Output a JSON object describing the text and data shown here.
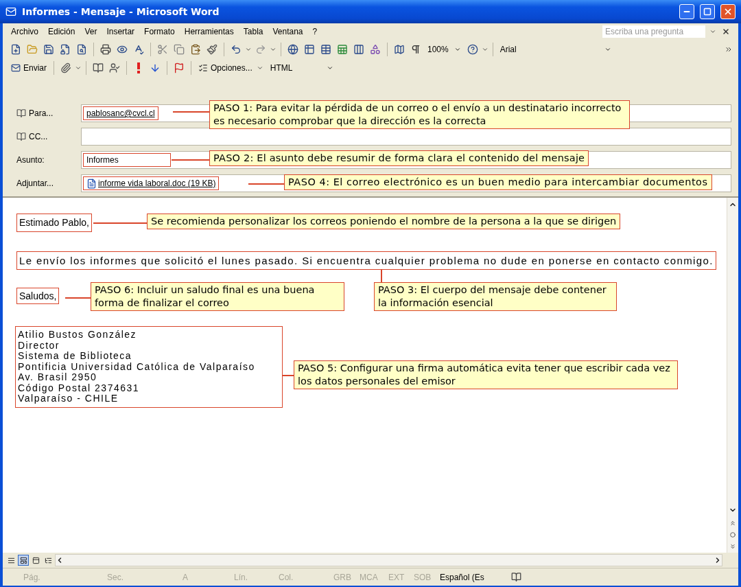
{
  "window": {
    "title": "Informes - Mensaje - Microsoft Word"
  },
  "menu": [
    {
      "label": "Archivo"
    },
    {
      "label": "Edición"
    },
    {
      "label": "Ver"
    },
    {
      "label": "Insertar"
    },
    {
      "label": "Formato"
    },
    {
      "label": "Herramientas"
    },
    {
      "label": "Tabla"
    },
    {
      "label": "Ventana"
    },
    {
      "label": "?"
    }
  ],
  "help_search": {
    "placeholder": "Escriba una pregunta"
  },
  "toolbar": {
    "zoom": "100%",
    "font": "Arial"
  },
  "mail_toolbar": {
    "send": "Enviar",
    "options": "Opciones...",
    "format": "HTML"
  },
  "header_fields": [
    {
      "kind": "address",
      "label": "Para...",
      "value": "pablosanc@cvcl.cl",
      "note": "PASO 1: Para evitar la pérdida de un correo o el envío a un destinatario incorrecto es necesario comprobar que la dirección es la correcta"
    },
    {
      "kind": "address",
      "label": "CC..."
    },
    {
      "kind": "text",
      "label": "Asunto:",
      "value": "Informes",
      "note": "PASO 2: El asunto debe resumir de forma clara el contenido del mensaje"
    },
    {
      "kind": "attachment",
      "label": "Adjuntar...",
      "value": "informe vida laboral.doc (19 KB)",
      "note": "PASO 4: El correo electrónico es un buen medio para intercambiar documentos"
    }
  ],
  "message": {
    "greeting": {
      "text": "Estimado Pablo,",
      "note": "Se recomienda personalizar los correos poniendo el nombre de la persona a la que se dirigen"
    },
    "body": {
      "text": "Le envío los informes que solicitó el lunes pasado. Si encuentra cualquier problema no dude en ponerse en contacto conmigo.",
      "note": "PASO 3: El cuerpo del mensaje debe contener la información esencial"
    },
    "closing": {
      "text": "Saludos,",
      "note": "PASO 6: Incluir un saludo final es una buena forma de finalizar el correo"
    },
    "signature": {
      "lines": [
        "Atilio Bustos González",
        "Director",
        "Sistema de Biblioteca",
        "Pontificia Universidad Católica de Valparaíso",
        "Av. Brasil 2950",
        "Código Postal 2374631",
        "Valparaíso - CHILE"
      ],
      "note": "PASO 5: Configurar una firma automática evita tener que escribir cada vez los datos personales del emisor"
    }
  },
  "view_buttons": [
    {
      "selected": false
    },
    {
      "selected": true
    },
    {
      "selected": false
    },
    {
      "selected": false
    }
  ],
  "status_bar": [
    {
      "text": "Pág.",
      "disabled": true
    },
    {
      "text": "Sec.",
      "disabled": true
    },
    {
      "text": "A",
      "disabled": true
    },
    {
      "text": "Lín.",
      "disabled": true
    },
    {
      "text": "Col.",
      "disabled": true
    },
    {
      "text": "GRB",
      "disabled": true
    },
    {
      "text": "MCA",
      "disabled": true
    },
    {
      "text": "EXT",
      "disabled": true
    },
    {
      "text": "SOB",
      "disabled": true
    },
    {
      "text": "Español (Es",
      "disabled": false
    }
  ]
}
